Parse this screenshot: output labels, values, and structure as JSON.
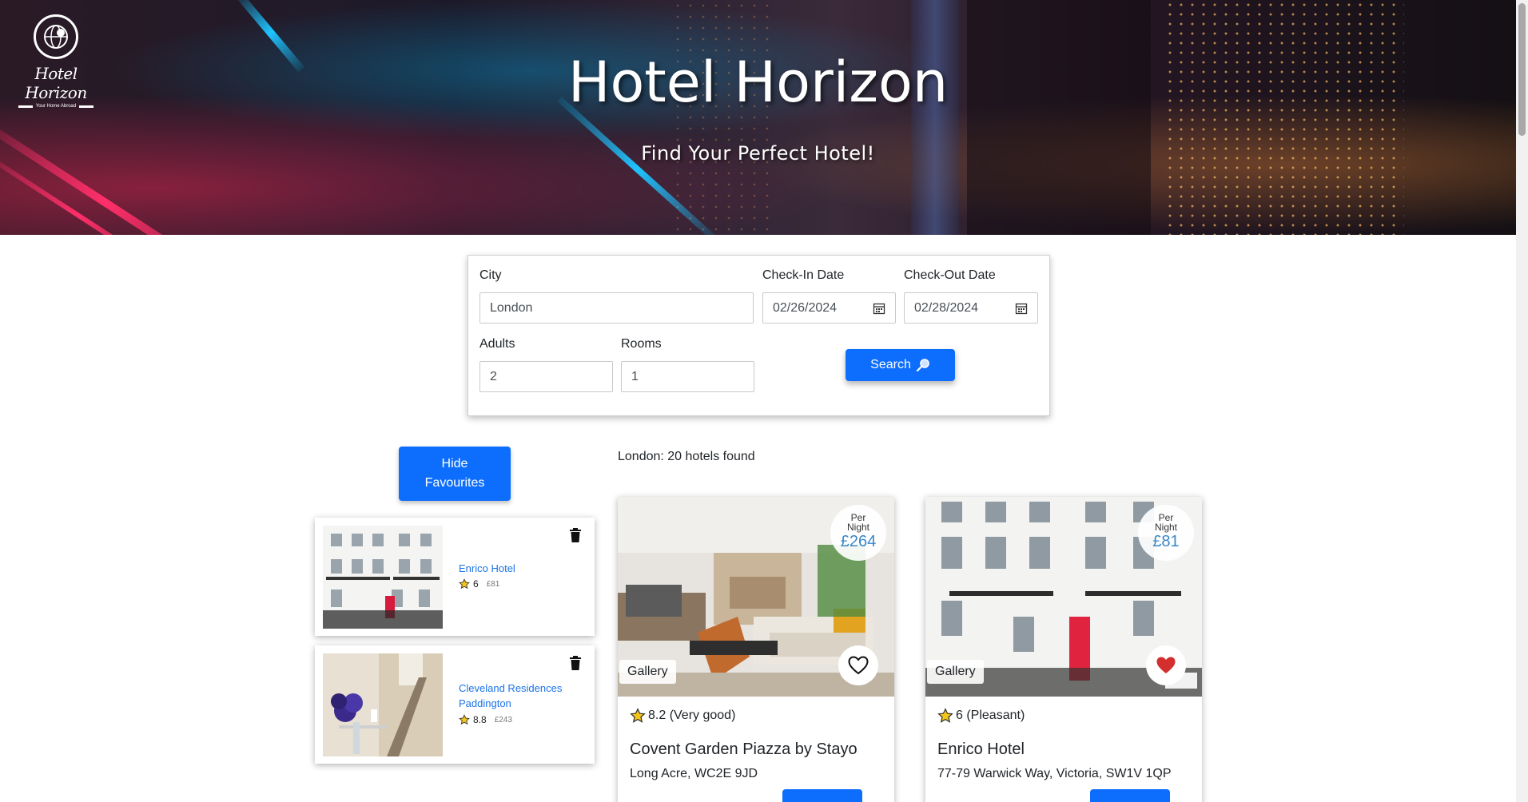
{
  "hero": {
    "title": "Hotel Horizon",
    "subtitle": "Find Your Perfect Hotel!",
    "logo_text": "Hotel Horizon",
    "logo_tagline": "Your Home Abroad"
  },
  "search": {
    "city_label": "City",
    "city_value": "London",
    "checkin_label": "Check-In Date",
    "checkin_value": "02/26/2024",
    "checkout_label": "Check-Out Date",
    "checkout_value": "02/28/2024",
    "adults_label": "Adults",
    "adults_value": "2",
    "rooms_label": "Rooms",
    "rooms_value": "1",
    "search_button": "Search"
  },
  "favourites": {
    "toggle_button": "Hide Favourites",
    "items": [
      {
        "name": "Enrico Hotel",
        "rating": "6",
        "price": "£81"
      },
      {
        "name": "Cleveland Residences Paddington",
        "rating": "8.8",
        "price": "£243"
      }
    ]
  },
  "results": {
    "summary": "London: 20 hotels found",
    "hotels": [
      {
        "per_night_label": "Per Night",
        "price": "£264",
        "gallery_label": "Gallery",
        "favourited": false,
        "rating": "8.2 (Very good)",
        "name": "Covent Garden Piazza by Stayo",
        "address": "Long Acre, WC2E 9JD"
      },
      {
        "per_night_label": "Per Night",
        "price": "£81",
        "gallery_label": "Gallery",
        "favourited": true,
        "rating": "6 (Pleasant)",
        "name": "Enrico Hotel",
        "address": "77-79 Warwick Way, Victoria, SW1V 1QP"
      }
    ]
  },
  "colors": {
    "primary": "#0d6efd",
    "link": "#1a73e8",
    "price": "#3a87c8",
    "heart": "#d32f2f",
    "star": "#f5c518"
  }
}
